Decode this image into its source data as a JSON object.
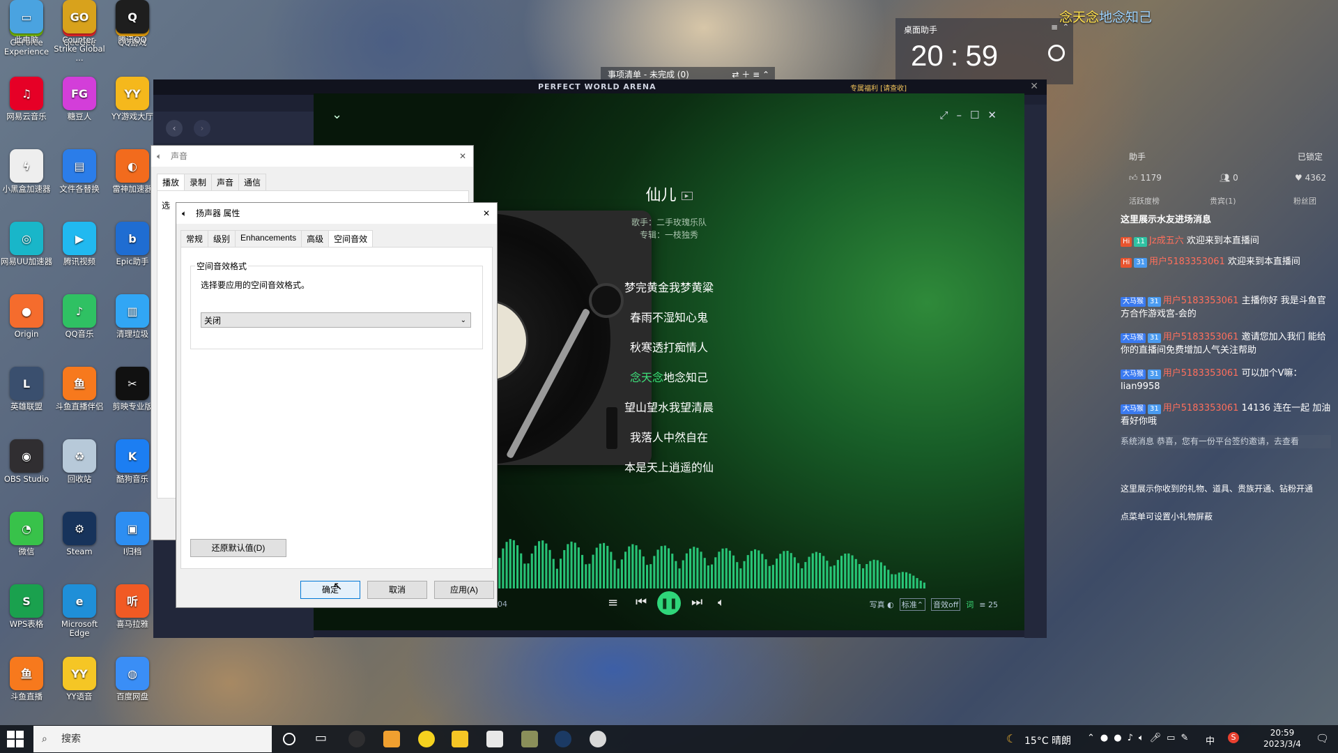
{
  "desktop": {
    "icons": [
      {
        "label": "GeForce Experience",
        "color": "#76b900",
        "glyph": "◣"
      },
      {
        "label": "GeeGee",
        "color": "#e8262a",
        "glyph": "GG"
      },
      {
        "label": "QQ游戏",
        "color": "#e9a20c",
        "glyph": "◕"
      },
      {
        "label": "网易云音乐",
        "color": "#e60026",
        "glyph": "♫"
      },
      {
        "label": "糖豆人",
        "color": "#d33ed9",
        "glyph": "FG"
      },
      {
        "label": "YY游戏大厅",
        "color": "#f5b81c",
        "glyph": "YY"
      },
      {
        "label": "小黑盒加速器",
        "color": "#eeeeee",
        "glyph": "ϟ"
      },
      {
        "label": "文件各替换",
        "color": "#2b7de9",
        "glyph": "▤"
      },
      {
        "label": "雷神加速器",
        "color": "#f26b1d",
        "glyph": "◐"
      },
      {
        "label": "网易UU加速器",
        "color": "#19b6c9",
        "glyph": "◎"
      },
      {
        "label": "腾讯视频",
        "color": "#21b9f0",
        "glyph": "▶"
      },
      {
        "label": "Epic助手",
        "color": "#1f6dd2",
        "glyph": "b"
      },
      {
        "label": "Origin",
        "color": "#f56c2d",
        "glyph": "●"
      },
      {
        "label": "QQ音乐",
        "color": "#2fc163",
        "glyph": "♪"
      },
      {
        "label": "清理垃圾",
        "color": "#31a6f5",
        "glyph": "▥"
      },
      {
        "label": "英雄联盟",
        "color": "#3a4f6e",
        "glyph": "L"
      },
      {
        "label": "斗鱼直播伴侣",
        "color": "#f7791d",
        "glyph": "鱼"
      },
      {
        "label": "剪映专业版",
        "color": "#111111",
        "glyph": "✂"
      },
      {
        "label": "OBS Studio",
        "color": "#302e31",
        "glyph": "◉"
      },
      {
        "label": "回收站",
        "color": "#b7c9d9",
        "glyph": "♻"
      },
      {
        "label": "酷狗音乐",
        "color": "#1c7ef2",
        "glyph": "K"
      },
      {
        "label": "微信",
        "color": "#38c24a",
        "glyph": "◔"
      },
      {
        "label": "Steam",
        "color": "#17335b",
        "glyph": "⚙"
      },
      {
        "label": "I归档",
        "color": "#2d8ef2",
        "glyph": "▣"
      },
      {
        "label": "WPS表格",
        "color": "#1aa14e",
        "glyph": "S"
      },
      {
        "label": "Microsoft Edge",
        "color": "#1f8fd8",
        "glyph": "e"
      },
      {
        "label": "喜马拉雅",
        "color": "#f15a24",
        "glyph": "听"
      },
      {
        "label": "斗鱼直播",
        "color": "#f7791d",
        "glyph": "鱼"
      },
      {
        "label": "YY语音",
        "color": "#f5c625",
        "glyph": "YY"
      },
      {
        "label": "百度网盘",
        "color": "#3a8ef6",
        "glyph": "◍"
      },
      {
        "label": "此电脑",
        "color": "#4aa3e0",
        "glyph": "▭"
      },
      {
        "label": "Counter-Strike Global ...",
        "color": "#d8a21c",
        "glyph": "GO"
      },
      {
        "label": "腾讯QQ",
        "color": "#1e1e1e",
        "glyph": "Q"
      }
    ]
  },
  "todo_bar": {
    "label": "事项清单 - 未完成 (0)"
  },
  "desktop_helper": {
    "title": "桌面助手",
    "time_hour": "20",
    "time_min": "59"
  },
  "overlay_lyric_line": {
    "highlight": "念天念",
    "rest": "地念知己"
  },
  "game_window": {
    "title": "PERFECT WORLD ARENA",
    "status": "专属福利 [请查收]"
  },
  "player": {
    "song_title": "仙儿",
    "artist": "歌手：二手玫瑰乐队",
    "album": "专辑：一枝独秀",
    "lyrics": [
      {
        "text": "梦完黄金我梦黄粱",
        "current": false
      },
      {
        "text": "春雨不湿知心鬼",
        "current": false
      },
      {
        "text": "秋寒透打痴情人",
        "current": false
      },
      {
        "text": "念天念",
        "current": true,
        "rest": "地念知己"
      },
      {
        "text": "望山望水我望清晨",
        "current": false
      },
      {
        "text": "我落人中然自在",
        "current": false
      },
      {
        "text": "本是天上逍遥的仙",
        "current": false
      }
    ],
    "time_elapsed": "04",
    "options": {
      "photo": "写真",
      "quality": "标准",
      "effect": "音效off",
      "lyric": "词",
      "count": "25"
    }
  },
  "sound_dialog": {
    "title": "声音",
    "tabs": [
      "播放",
      "录制",
      "声音",
      "通信"
    ],
    "select_prefix": "选"
  },
  "speaker_dialog": {
    "title": "扬声器 属性",
    "tabs": [
      "常规",
      "级别",
      "Enhancements",
      "高级",
      "空间音效"
    ],
    "group_label": "空间音效格式",
    "description": "选择要应用的空间音效格式。",
    "dropdown_value": "关闭",
    "reset_button": "还原默认值(D)",
    "ok_button": "确定",
    "cancel_button": "取消",
    "apply_button": "应用(A)"
  },
  "live_panel": {
    "title": "助手",
    "locked": "已锁定",
    "stats": [
      "1179",
      "0",
      "4362"
    ],
    "tabs": [
      "活跃度榜",
      "贵宾(1)",
      "粉丝团"
    ],
    "welcome_note": "这里展示水友进场消息",
    "entries": [
      {
        "badge": "Hi",
        "level": "11",
        "name": "Jz成五六",
        "msg": "欢迎来到本直播间"
      },
      {
        "badge": "Hi",
        "level": "31",
        "name": "用户5183353061",
        "msg": "欢迎来到本直播间"
      }
    ],
    "chats": [
      {
        "tag": "大马猴",
        "level": "31",
        "name": "用户5183353061",
        "msg": "主播你好 我是斗鱼官方合作游戏宫-会的"
      },
      {
        "tag": "大马猴",
        "level": "31",
        "name": "用户5183353061",
        "msg": "邀请您加入我们 能给你的直播间免费增加人气关注帮助"
      },
      {
        "tag": "大马猴",
        "level": "31",
        "name": "用户5183353061",
        "msg": "可以加个V嘛：lian9958"
      },
      {
        "tag": "大马猴",
        "level": "31",
        "name": "用户5183353061",
        "msg": "14136 连在一起 加油看好你哦"
      }
    ],
    "system_msg": "系统消息  恭喜，您有一份平台签约邀请，去查看",
    "gift_note": "这里展示你收到的礼物、道具、贵族开通、钻粉开通",
    "gift_note2": "点菜单可设置小礼物屏蔽"
  },
  "taskbar": {
    "search_placeholder": "搜索",
    "weather": "15°C 晴朗",
    "ime": "中",
    "clock_time": "20:59",
    "clock_date": "2023/3/4"
  }
}
